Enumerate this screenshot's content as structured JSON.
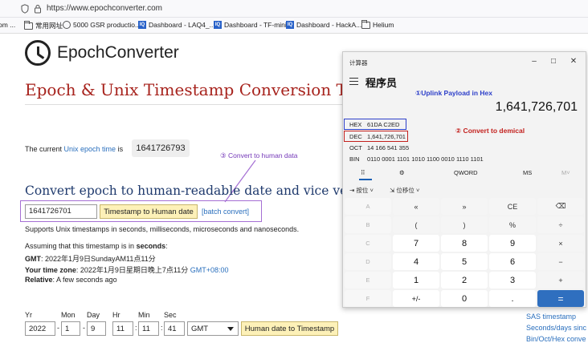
{
  "browser": {
    "url": "https://www.epochconverter.com",
    "icons": [
      "shield-icon",
      "lock-icon"
    ],
    "bookmarks": [
      {
        "label": "om ...",
        "icon": "none"
      },
      {
        "label": "常用网址",
        "icon": "folder-icon"
      },
      {
        "label": "5000 GSR productio...",
        "icon": "globe-icon"
      },
      {
        "label": "Dashboard - LAQ4_...",
        "icon": "iq-icon"
      },
      {
        "label": "Dashboard - TF-mini",
        "icon": "iq-icon"
      },
      {
        "label": "Dashboard - HackA...",
        "icon": "iq-icon"
      },
      {
        "label": "Helium",
        "icon": "folder-icon"
      }
    ]
  },
  "page": {
    "logo_epoch": "Epoch",
    "logo_converter": "Converter",
    "title": "Epoch & Unix Timestamp Conversion Tools",
    "current_prefix": "The current ",
    "current_link": "Unix epoch time",
    "current_suffix": " is",
    "current_value": "1641726793",
    "annotation3": "③  Convert to human  data",
    "section_title": "Convert epoch to human-readable date and vice versa",
    "input_value": "1641726701",
    "convert_button": "Timestamp to Human date",
    "batch_link": "[batch convert]",
    "supports": "Supports Unix timestamps in seconds, milliseconds, microseconds and nanoseconds.",
    "assuming_prefix": "Assuming that this timestamp is in ",
    "assuming_unit": "seconds",
    "assuming_suffix": ":",
    "gmt_label": "GMT",
    "gmt_value": ": 2022年1月9日SundayAM11点11分",
    "tz_label": "Your time zone",
    "tz_value": ": 2022年1月9日星期日晚上7点11分 ",
    "tz_offset": "GMT+08:00",
    "relative_label": "Relative",
    "relative_value": ": A few seconds ago",
    "date_labels": {
      "yr": "Yr",
      "mon": "Mon",
      "day": "Day",
      "hr": "Hr",
      "min": "Min",
      "sec": "Sec"
    },
    "date_values": {
      "yr": "2022",
      "mon": "1",
      "day": "9",
      "hr": "11",
      "min": "11",
      "sec": "41"
    },
    "tz_select": "GMT",
    "h2t_button": "Human date to Timestamp",
    "right_links": [
      "SAS timestamp",
      "Seconds/days sinc",
      "Bin/Oct/Hex conve"
    ]
  },
  "calculator": {
    "window_title": "计算器",
    "mode": "程序员",
    "display": "1,641,726,701",
    "annotation1": "①Uplink Payload in  Hex",
    "annotation2": "②   Convert to demical",
    "radix": [
      {
        "label": "HEX",
        "value": "61DA C2ED"
      },
      {
        "label": "DEC",
        "value": "1,641,726,701"
      },
      {
        "label": "OCT",
        "value": "14 166 541 355"
      },
      {
        "label": "BIN",
        "value": "0110 0001 1101 1010 1100 0010 1110 1101"
      }
    ],
    "modes": {
      "keypad": "⠿",
      "bitflip": "⚙",
      "word": "QWORD",
      "ms": "MS",
      "mstar": "M˅"
    },
    "ops": {
      "bitwise": "按位 ˅",
      "shift": "位移位 ˅"
    },
    "keys": [
      [
        "A",
        "«",
        "»",
        "CE",
        "⌫"
      ],
      [
        "B",
        "(",
        ")",
        "%",
        "÷"
      ],
      [
        "C",
        "7",
        "8",
        "9",
        "×"
      ],
      [
        "D",
        "4",
        "5",
        "6",
        "−"
      ],
      [
        "E",
        "1",
        "2",
        "3",
        "+"
      ],
      [
        "F",
        "+/-",
        "0",
        ".",
        "="
      ]
    ],
    "accent": "#2f6fbf"
  },
  "colors": {
    "title_red": "#a7231d",
    "link_blue": "#2a6fbd",
    "purple": "#a56fd4",
    "hex_blue": "#2d3fc9",
    "dec_red": "#c3201d"
  }
}
